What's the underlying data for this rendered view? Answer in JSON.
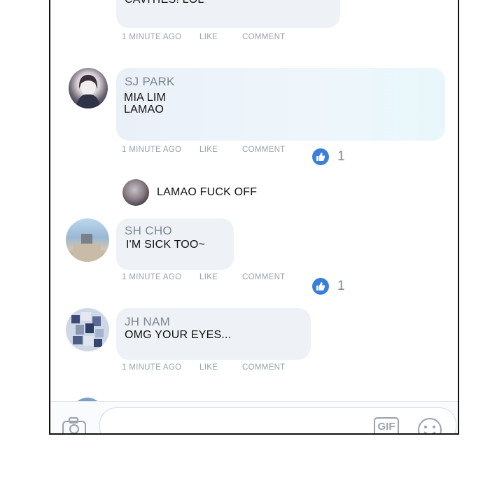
{
  "top_comment": {
    "text": "CAVITIES! LOL",
    "meta": {
      "time": "1 MINUTE AGO",
      "like": "LIKE",
      "comment": "COMMENT"
    }
  },
  "comments": [
    {
      "name": "SJ PARK",
      "lines": [
        "MIA LIM",
        "LAMAO"
      ],
      "meta": {
        "time": "1 MINUTE AGO",
        "like": "LIKE",
        "comment": "COMMENT"
      },
      "likes": "1"
    },
    {
      "reply_text": "LAMAO FUCK OFF"
    },
    {
      "name": "SH CHO",
      "text": "I'M SICK TOO~",
      "meta": {
        "time": "1 MINUTE AGO",
        "like": "LIKE",
        "comment": "COMMENT"
      },
      "likes": "1"
    },
    {
      "name": "JH NAM",
      "text": "OMG YOUR EYES...",
      "meta": {
        "time": "1 MINUTE AGO",
        "like": "LIKE",
        "comment": "COMMENT"
      }
    }
  ],
  "composer": {
    "icons": [
      "camera-icon",
      "gif-icon",
      "emoji-icon"
    ],
    "gif_label": "GIF"
  },
  "colors": {
    "like_blue": "#3c7fd6",
    "bubble": "#eef1f6",
    "meta_gray": "#9aa2ad"
  }
}
